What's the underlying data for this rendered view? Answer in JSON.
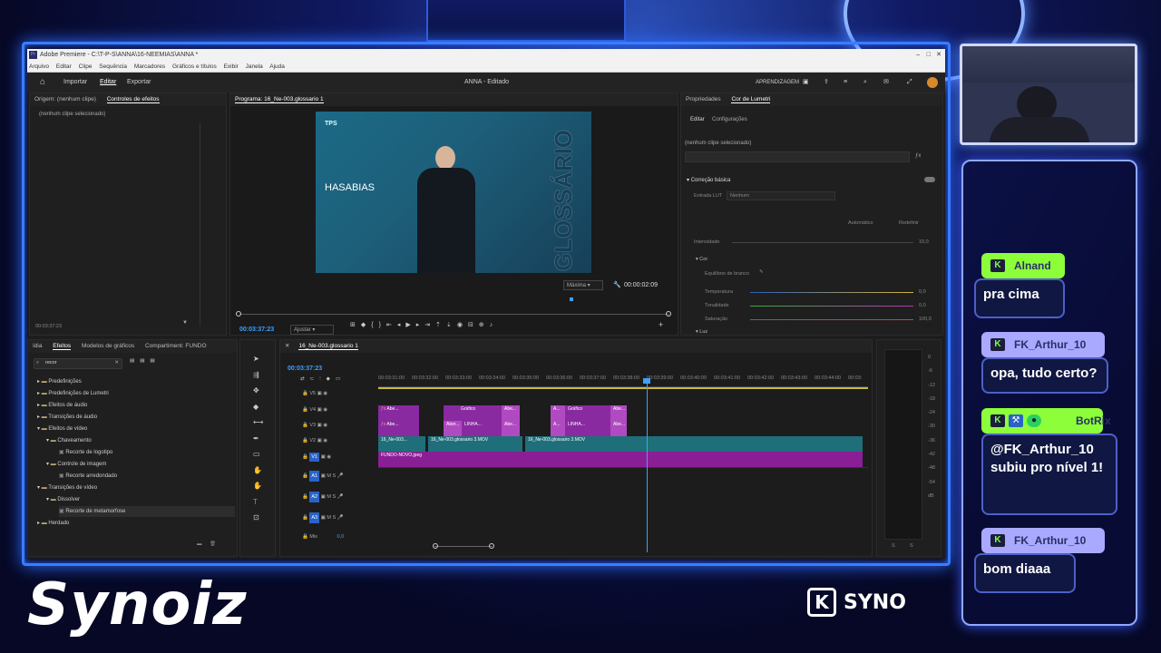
{
  "window": {
    "title": "Adobe Premiere - C:\\T-P-S\\ANNA\\16-NEEMIAS\\ANNA *",
    "menu": [
      "Arquivo",
      "Editar",
      "Clipe",
      "Sequência",
      "Marcadores",
      "Gráficos e títulos",
      "Exibir",
      "Janela",
      "Ajuda"
    ]
  },
  "topbar": {
    "tabs": [
      "Importar",
      "Editar",
      "Exportar"
    ],
    "active_tab": "Editar",
    "project": "ANNA - Editado",
    "workspace": "APRENDIZAGEM"
  },
  "source_panel": {
    "tab_origin": "Origem: (nenhum clipe)",
    "tab_effects": "Controles de efeitos",
    "empty_text": "(nenhum clipe selecionado)",
    "timecode": "00:03:37:23"
  },
  "program": {
    "title": "Programa: 16_Ne-003.glossario 1",
    "overlay_word": "HASABIAS",
    "logo": "TPS",
    "vertical_word": "GLOSSÁRIO",
    "timecode_left": "00:03:37:23",
    "fit": "Ajustar",
    "quality": "Máxima",
    "timecode_right": "00:00:02:09"
  },
  "lumetri": {
    "tab_props": "Propriedades",
    "tab_lumetri": "Cor de Lumetri",
    "sub_edit": "Editar",
    "sub_config": "Configurações",
    "no_clip": "(nenhum clipe selecionado)",
    "section_basic": "Correção básica",
    "lut_label": "Entrada LUT",
    "lut_value": "Nenhum",
    "auto": "Automático",
    "reset": "Redefinir",
    "intensity": "Intensidade",
    "intensity_value": "10,0",
    "section_color": "Cor",
    "white_balance": "Equilíbrio de branco",
    "temperature": "Temperatura",
    "temperature_value": "0,0",
    "tint": "Tonalidade",
    "tint_value": "0,0",
    "saturation": "Saturação",
    "saturation_value": "100,0",
    "section_light": "Luz"
  },
  "effects_panel": {
    "tab_left": "ídia",
    "tab_effects": "Efeitos",
    "tab_models": "Modelos de gráficos",
    "tab_share": "Compartiment: FUNDO",
    "search_value": "recor",
    "items": [
      {
        "label": "Predefinições",
        "level": 0
      },
      {
        "label": "Predefinições de Lumetri",
        "level": 0
      },
      {
        "label": "Efeitos de áudio",
        "level": 0
      },
      {
        "label": "Transições de áudio",
        "level": 0
      },
      {
        "label": "Efeitos de vídeo",
        "level": 0
      },
      {
        "label": "Chaveamento",
        "level": 1
      },
      {
        "label": "Recorte de logotipo",
        "level": 2
      },
      {
        "label": "Controle de imagem",
        "level": 1
      },
      {
        "label": "Recorte arredondado",
        "level": 2
      },
      {
        "label": "Transições de vídeo",
        "level": 0
      },
      {
        "label": "Dissolver",
        "level": 1
      },
      {
        "label": "Recorte de metamorfose",
        "level": 2
      },
      {
        "label": "Herdado",
        "level": 0
      }
    ]
  },
  "timeline": {
    "sequence": "16_Ne-003.glossario 1",
    "timecode": "00:03:37:23",
    "ruler": [
      "00:03:31:00",
      "00:03:32:00",
      "00:03:33:00",
      "00:03:34:00",
      "00:03:35:00",
      "00:03:36:00",
      "00:03:37:00",
      "00:03:38:00",
      "00:03:39:00",
      "00:03:40:00",
      "00:03:41:00",
      "00:03:42:00",
      "00:03:43:00",
      "00:03:44:00",
      "00:03:"
    ],
    "tracks": [
      "V5",
      "V4",
      "V3",
      "V2",
      "V1",
      "A1",
      "A2",
      "A3"
    ],
    "mix_label": "Mix",
    "mix_value": "0,0",
    "clips": {
      "v4_a": "Abe...",
      "v4_b": "Gráfico",
      "v4_c": "Abe...",
      "v4_d": "A...",
      "v4_e": "Gráfico",
      "v4_f": "Abe...",
      "v3_a": "Abe...",
      "v3_b": "Aber...",
      "v3_c": "LINHA...",
      "v3_d": "Abe...",
      "v3_e": "A...",
      "v3_f": "LINHA...",
      "v3_g": "Abe...",
      "v2_a": "16_Ne-003...",
      "v2_b": "16_Ne-003.glossario 3.MOV",
      "v2_c": "16_Ne-003.glossario 3.MOV",
      "v1_a": "FUNDO-NOVO.jpeg"
    }
  },
  "meter": {
    "scale": [
      "0",
      "-6",
      "-12",
      "-18",
      "-24",
      "-30",
      "-36",
      "-42",
      "-48",
      "-54",
      "dB"
    ],
    "channels": [
      "S",
      "S"
    ]
  },
  "chat": [
    {
      "user": "Alnand",
      "message": "pra cima",
      "color": "#8cff3a"
    },
    {
      "user": "FK_Arthur_10",
      "message": "opa, tudo certo?",
      "color": "#a9a9ff"
    },
    {
      "user": "BotRix",
      "message": "@FK_Arthur_10 subiu pro nível 1!",
      "color": "#8cff3a"
    },
    {
      "user": "FK_Arthur_10",
      "message": "bom diaaa",
      "color": "#a9a9ff"
    }
  ],
  "brand": {
    "logo_text": "Synoiz",
    "corner_text": "SYNO",
    "corner_k": "K"
  },
  "colors": {
    "accent": "#3a7cff",
    "timeline_blue": "#3ea0ff",
    "clip_purple": "#8a2aa0",
    "clip_teal": "#1f6f7a"
  }
}
